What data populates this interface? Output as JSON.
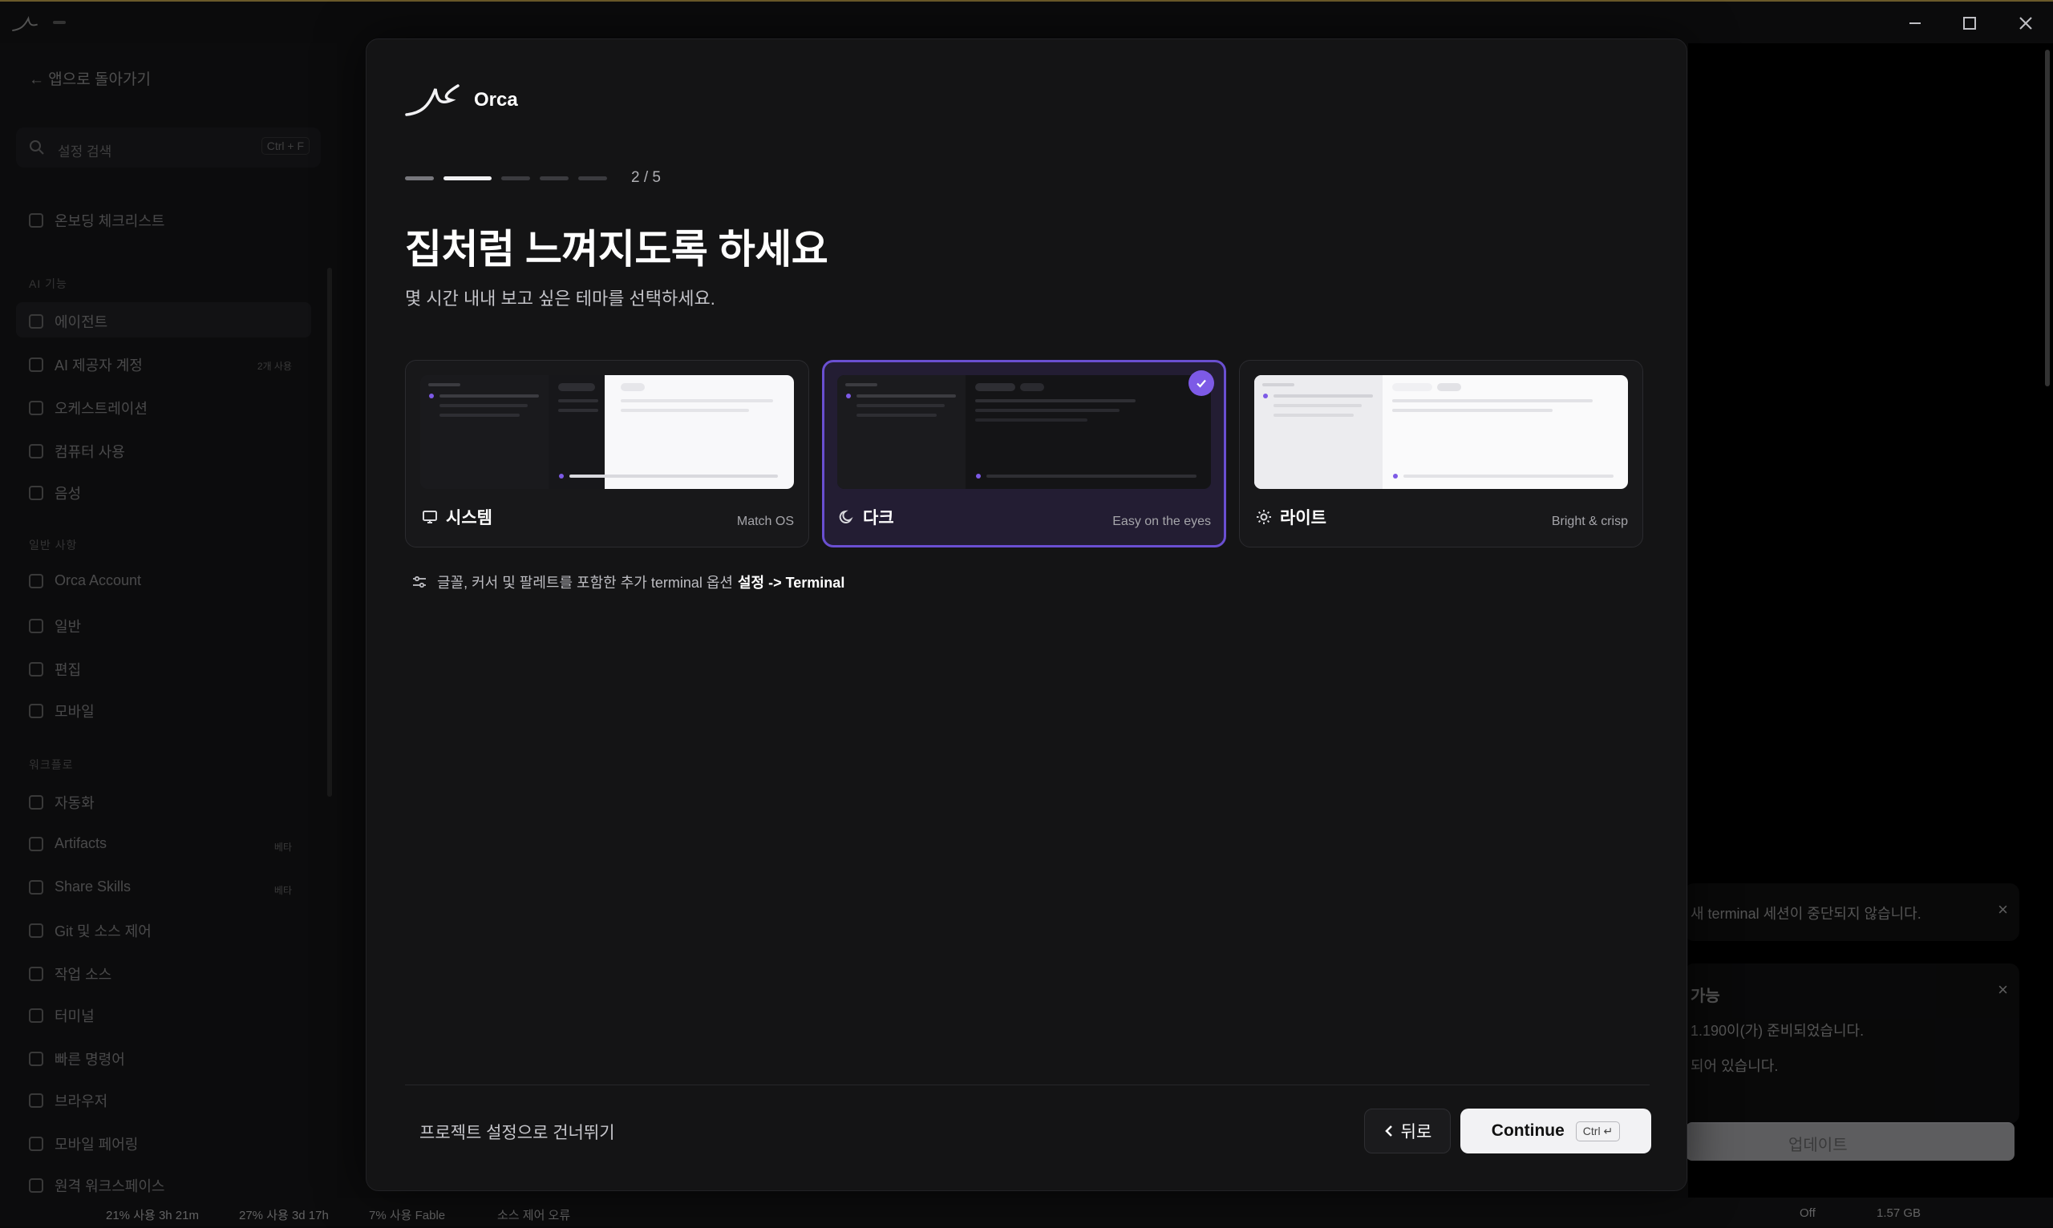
{
  "window": {
    "minimize_icon": "minimize-icon",
    "maximize_icon": "maximize-icon",
    "close_icon": "close-icon"
  },
  "background_sidebar": {
    "back_label": "앱으로 돌아가기",
    "search_placeholder": "설정 검색",
    "search_kbd": "Ctrl + F",
    "onboarding": "온보딩 체크리스트",
    "section_ai": "AI 기능",
    "items_ai": [
      "에이전트",
      "AI 제공자 계정",
      "오케스트레이션",
      "컴퓨터 사용",
      "음성"
    ],
    "section_general": "일반 사항",
    "items_general": [
      "Orca Account",
      "일반",
      "편집",
      "모바일"
    ],
    "section_workspace": "워크플로",
    "items_workspace": [
      "자동화",
      "Artifacts",
      "Share Skills",
      "Git 및 소스 제어",
      "작업 소스",
      "터미널",
      "빠른 명령어",
      "브라우저",
      "모바일 페어링",
      "원격 워크스페이스"
    ],
    "badge_ai_accounts": "2개 사용",
    "badge_new": "베타"
  },
  "background_toasts": {
    "toast1_text": "새 terminal 세션이 중단되지 않습니다.",
    "toast2_title": "가능",
    "toast2_line1": "1.190이(가) 준비되었습니다.",
    "toast2_line2": "되어 있습니다.",
    "toast2_button": "업데이트"
  },
  "status_bar": {
    "items": [
      "21% 사용 3h 21m",
      "27% 사용 3d 17h",
      "7% 사용 Fable",
      "소스 제어 오류"
    ],
    "right_items": [
      "Off",
      "1.57 GB"
    ]
  },
  "modal": {
    "brand_name": "Orca",
    "progress": {
      "current": 2,
      "total": 5,
      "label": "2 / 5"
    },
    "title": "집처럼 느껴지도록 하세요",
    "subtitle": "몇 시간 내내 보고 싶은 테마를 선택하세요.",
    "themes": [
      {
        "name": "시스템",
        "hint": "Match OS",
        "icon": "monitor-icon",
        "selected": false
      },
      {
        "name": "다크",
        "hint": "Easy on the eyes",
        "icon": "moon-icon",
        "selected": true
      },
      {
        "name": "라이트",
        "hint": "Bright & crisp",
        "icon": "sun-icon",
        "selected": false
      }
    ],
    "terminal_hint_prefix": "글꼴, 커서 및 팔레트를 포함한 추가 terminal 옵션",
    "terminal_hint_link": "설정 -> Terminal",
    "skip_label": "프로젝트 설정으로 건너뛰기",
    "back_label": "뒤로",
    "continue_label": "Continue",
    "continue_kbd": "Ctrl ↵"
  },
  "colors": {
    "accent": "#7d5ae6",
    "selected_border": "#6a4fd1",
    "modal_bg": "#141415"
  }
}
